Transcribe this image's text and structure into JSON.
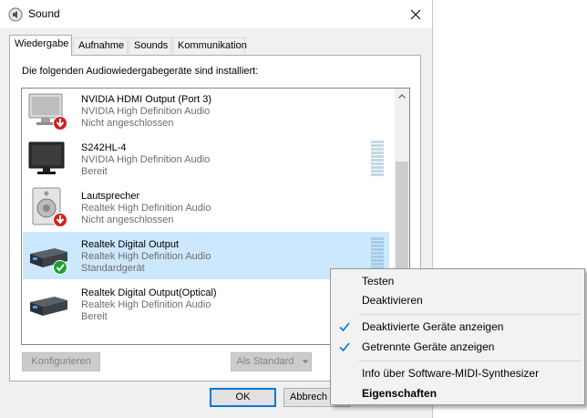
{
  "window": {
    "title": "Sound"
  },
  "tabs": [
    {
      "label": "Wiedergabe",
      "active": true
    },
    {
      "label": "Aufnahme",
      "active": false
    },
    {
      "label": "Sounds",
      "active": false
    },
    {
      "label": "Kommunikation",
      "active": false
    }
  ],
  "panel": {
    "instruction": "Die folgenden Audiowiedergabegeräte sind installiert:"
  },
  "devices": [
    {
      "name": "NVIDIA HDMI Output (Port 3)",
      "driver": "NVIDIA High Definition Audio",
      "status": "Nicht angeschlossen",
      "icon": "monitor-disconnected-icon"
    },
    {
      "name": "S242HL-4",
      "driver": "NVIDIA High Definition Audio",
      "status": "Bereit",
      "icon": "monitor-icon"
    },
    {
      "name": "Lautsprecher",
      "driver": "Realtek High Definition Audio",
      "status": "Nicht angeschlossen",
      "icon": "speaker-disconnected-icon"
    },
    {
      "name": "Realtek Digital Output",
      "driver": "Realtek High Definition Audio",
      "status": "Standardgerät",
      "icon": "digital-output-default-icon",
      "selected": true
    },
    {
      "name": "Realtek Digital Output(Optical)",
      "driver": "Realtek High Definition Audio",
      "status": "Bereit",
      "icon": "digital-output-icon"
    }
  ],
  "buttons": {
    "configure": "Konfigurieren",
    "set_default": "Als Standard",
    "ok": "OK",
    "cancel": "Abbrech"
  },
  "context_menu": {
    "items": [
      {
        "label": "Testen",
        "checked": false
      },
      {
        "label": "Deaktivieren",
        "checked": false
      },
      {
        "label": "Deaktivierte Geräte anzeigen",
        "checked": true
      },
      {
        "label": "Getrennte Geräte anzeigen",
        "checked": true
      },
      {
        "label": "Info über Software-MIDI-Synthesizer",
        "checked": false
      },
      {
        "label": "Eigenschaften",
        "checked": false,
        "bold": true
      }
    ]
  },
  "colors": {
    "selection": "#cce8ff",
    "check": "#0078d7",
    "disconnected_badge": "#d42020",
    "default_badge": "#1aa130"
  }
}
